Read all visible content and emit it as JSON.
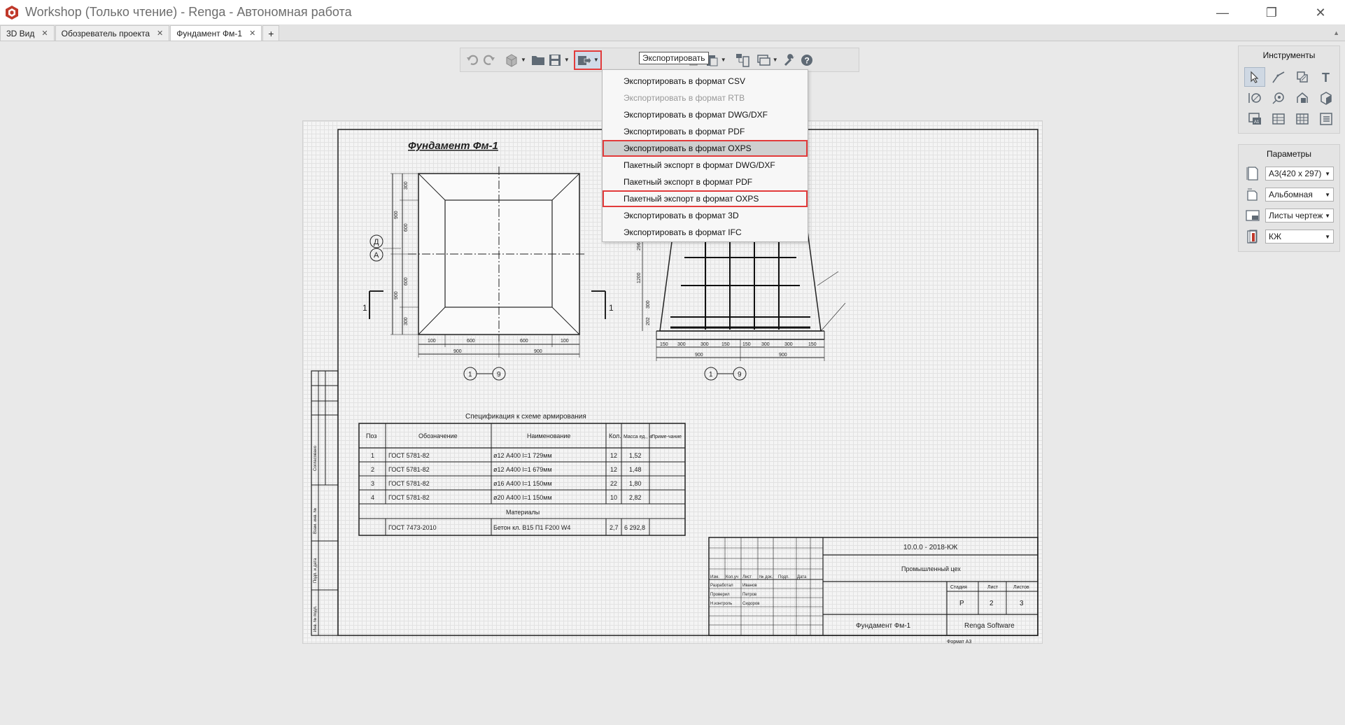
{
  "window": {
    "title": "Workshop (Только чтение) - Renga - Автономная работа",
    "minimize": "—",
    "maximize": "❐",
    "close": "✕"
  },
  "tabs": [
    {
      "label": "3D Вид",
      "close": "✕"
    },
    {
      "label": "Обозреватель проекта",
      "close": "✕"
    },
    {
      "label": "Фундамент Фм-1",
      "close": "✕"
    }
  ],
  "tab_add": "+",
  "tab_scroll": "▲",
  "toolbar": {
    "tooltip": "Экспортировать",
    "dropdown_arrow": "▼"
  },
  "export_menu": [
    "Экспортировать в формат CSV",
    "Экспортировать в формат RTB",
    "Экспортировать в формат DWG/DXF",
    "Экспортировать в формат PDF",
    "Экспортировать в формат OXPS",
    "Пакетный экспорт в формат DWG/DXF",
    "Пакетный экспорт в формат PDF",
    "Пакетный экспорт в формат OXPS",
    "Экспортировать в формат 3D",
    "Экспортировать в формат IFC"
  ],
  "tools_panel": {
    "title": "Инструменты"
  },
  "params_panel": {
    "title": "Параметры",
    "format": "А3(420 x 297)",
    "orientation": "Альбомная",
    "sheet_type": "Листы чертеж",
    "stamp": "КЖ",
    "arrow": "▼"
  },
  "drawing": {
    "title": "Фундамент Фм-1",
    "section_mark": "1",
    "axis_d": "Д",
    "axis_a": "А",
    "bar_range_start": "1",
    "bar_range_end": "9",
    "plan_dims_bottom": [
      "100",
      "600",
      "600",
      "100"
    ],
    "plan_dims_total": [
      "900",
      "900"
    ],
    "plan_dims_left": [
      "300",
      "600",
      "600",
      "300"
    ],
    "plan_dims_left_total": [
      "900",
      "900"
    ],
    "section_dims_bottom": [
      "150",
      "300",
      "300",
      "150",
      "150",
      "300",
      "300",
      "150"
    ],
    "section_dims_total": [
      "900",
      "900"
    ],
    "section_dims_left": [
      "296",
      "1200",
      "300",
      "202"
    ],
    "spec_title": "Спецификация к схеме армирования",
    "spec_headers": [
      "Поз",
      "Обозначение",
      "Наименование",
      "Кол.",
      "Масса ед., кг",
      "Приме-чание"
    ],
    "spec_rows": [
      [
        "1",
        "ГОСТ 5781-82",
        "ø12 А400    l=1 729мм",
        "12",
        "1,52",
        ""
      ],
      [
        "2",
        "ГОСТ 5781-82",
        "ø12 А400    l=1 679мм",
        "12",
        "1,48",
        ""
      ],
      [
        "3",
        "ГОСТ 5781-82",
        "ø16 А400    l=1 150мм",
        "22",
        "1,80",
        ""
      ],
      [
        "4",
        "ГОСТ 5781-82",
        "ø20 А400    l=1 150мм",
        "10",
        "2,82",
        ""
      ]
    ],
    "spec_materials": "Материалы",
    "spec_material_row": [
      "",
      "ГОСТ 7473-2010",
      "Бетон кл. B15 П1 F200 W4",
      "2,7",
      "6 292,8",
      ""
    ],
    "stamp_code": "10.0.0 - 2018-КЖ",
    "stamp_object": "Промышленный цех",
    "stamp_headers": [
      "Стадия",
      "Лист",
      "Листов"
    ],
    "stamp_values": [
      "Р",
      "2",
      "3"
    ],
    "stamp_sheet_name": "Фундамент Фм-1",
    "stamp_company": "Renga Software",
    "stamp_format": "Формат А3",
    "stamp_cols": [
      "Изм.",
      "Кол.уч",
      "Лист",
      "№ док.",
      "Подп.",
      "Дата"
    ],
    "stamp_people": [
      [
        "Разработал",
        "Иванов"
      ],
      [
        "Проверил",
        "Петров"
      ],
      [
        "Н.контроль",
        "Сидоров"
      ]
    ],
    "left_strip": [
      "Инв. № подл.",
      "Подп. и дата",
      "Взам. инв. №",
      "Согласовано"
    ]
  }
}
